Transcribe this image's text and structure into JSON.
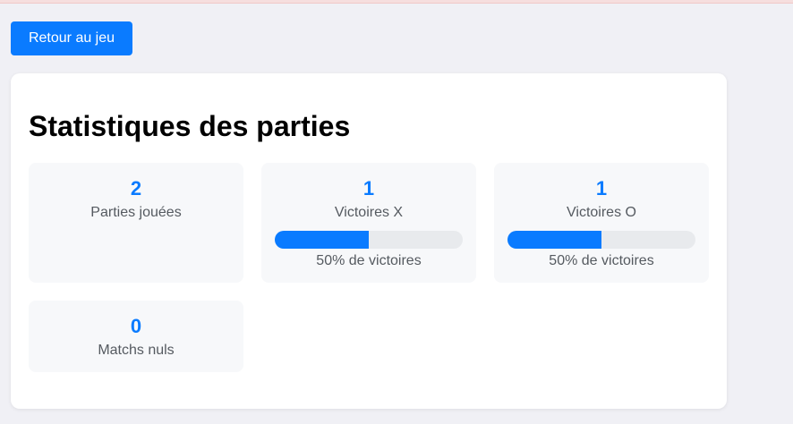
{
  "header": {
    "back_button_label": "Retour au jeu"
  },
  "stats_panel": {
    "title": "Statistiques des parties",
    "cards": [
      {
        "value": "2",
        "label": "Parties jouées"
      },
      {
        "value": "1",
        "label": "Victoires X",
        "win_rate": 0.5,
        "win_rate_text": "50% de victoires"
      },
      {
        "value": "1",
        "label": "Victoires O",
        "win_rate": 0.5,
        "win_rate_text": "50% de victoires"
      },
      {
        "value": "0",
        "label": "Matchs nuls"
      }
    ]
  },
  "colors": {
    "accent": "#0a7bff",
    "track": "#e8eaed",
    "card_bg": "#f7f8fa",
    "page_bg": "#f0f0f5"
  }
}
